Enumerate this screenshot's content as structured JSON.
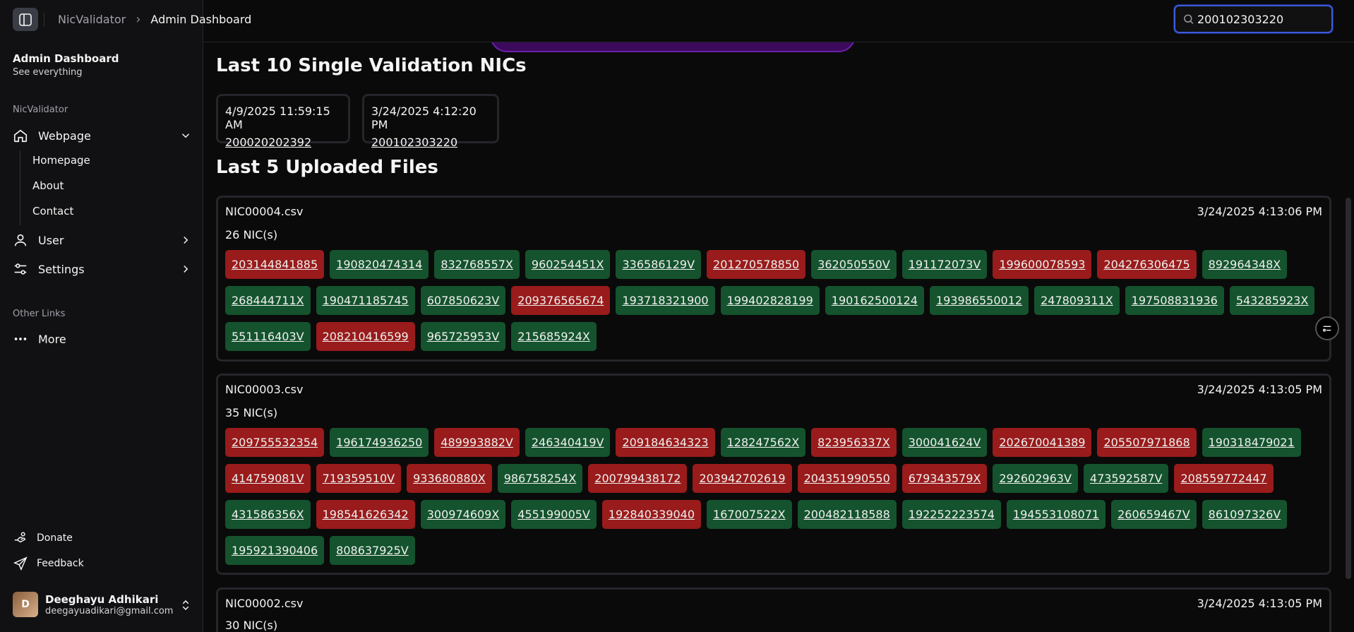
{
  "topbar": {
    "breadcrumb_root": "NicValidator",
    "breadcrumb_current": "Admin Dashboard",
    "search_value": "200102303220"
  },
  "sidebar": {
    "title": "Admin Dashboard",
    "subtitle": "See everything",
    "group_label": "NicValidator",
    "nav": {
      "webpage": "Webpage",
      "homepage": "Homepage",
      "about": "About",
      "contact": "Contact",
      "user": "User",
      "settings": "Settings"
    },
    "other_label": "Other Links",
    "more": "More",
    "donate": "Donate",
    "feedback": "Feedback",
    "user_name": "Deeghayu Adhikari",
    "user_email": "deegayuadikari@gmail.com"
  },
  "main": {
    "recent_heading": "Last 10 Single Validation NICs",
    "recent": [
      {
        "time": "4/9/2025 11:59:15 AM",
        "nic": "200020202392"
      },
      {
        "time": "3/24/2025 4:12:20 PM",
        "nic": "200102303220"
      }
    ],
    "files_heading": "Last 5 Uploaded Files",
    "files": [
      {
        "name": "NIC00004.csv",
        "time": "3/24/2025 4:13:06 PM",
        "count": "26 NIC(s)",
        "nics": [
          {
            "v": "203144841885",
            "ok": false
          },
          {
            "v": "190820474314",
            "ok": true
          },
          {
            "v": "832768557X",
            "ok": true
          },
          {
            "v": "960254451X",
            "ok": true
          },
          {
            "v": "336586129V",
            "ok": true
          },
          {
            "v": "201270578850",
            "ok": false
          },
          {
            "v": "362050550V",
            "ok": true
          },
          {
            "v": "191172073V",
            "ok": true
          },
          {
            "v": "199600078593",
            "ok": false
          },
          {
            "v": "204276306475",
            "ok": false
          },
          {
            "v": "892964348X",
            "ok": true
          },
          {
            "v": "268444711X",
            "ok": true
          },
          {
            "v": "190471185745",
            "ok": true
          },
          {
            "v": "607850623V",
            "ok": true
          },
          {
            "v": "209376565674",
            "ok": false
          },
          {
            "v": "193718321900",
            "ok": true
          },
          {
            "v": "199402828199",
            "ok": true
          },
          {
            "v": "190162500124",
            "ok": true
          },
          {
            "v": "193986550012",
            "ok": true
          },
          {
            "v": "247809311X",
            "ok": true
          },
          {
            "v": "197508831936",
            "ok": true
          },
          {
            "v": "543285923X",
            "ok": true
          },
          {
            "v": "551116403V",
            "ok": true
          },
          {
            "v": "208210416599",
            "ok": false
          },
          {
            "v": "965725953V",
            "ok": true
          },
          {
            "v": "215685924X",
            "ok": true
          }
        ]
      },
      {
        "name": "NIC00003.csv",
        "time": "3/24/2025 4:13:05 PM",
        "count": "35 NIC(s)",
        "nics": [
          {
            "v": "209755532354",
            "ok": false
          },
          {
            "v": "196174936250",
            "ok": true
          },
          {
            "v": "489993882V",
            "ok": false
          },
          {
            "v": "246340419V",
            "ok": true
          },
          {
            "v": "209184634323",
            "ok": false
          },
          {
            "v": "128247562X",
            "ok": true
          },
          {
            "v": "823956337X",
            "ok": false
          },
          {
            "v": "300041624V",
            "ok": true
          },
          {
            "v": "202670041389",
            "ok": false
          },
          {
            "v": "205507971868",
            "ok": false
          },
          {
            "v": "190318479021",
            "ok": true
          },
          {
            "v": "414759081V",
            "ok": false
          },
          {
            "v": "719359510V",
            "ok": false
          },
          {
            "v": "933680880X",
            "ok": false
          },
          {
            "v": "986758254X",
            "ok": true
          },
          {
            "v": "200799438172",
            "ok": false
          },
          {
            "v": "203942702619",
            "ok": false
          },
          {
            "v": "204351990550",
            "ok": false
          },
          {
            "v": "679343579X",
            "ok": false
          },
          {
            "v": "292602963V",
            "ok": true
          },
          {
            "v": "473592587V",
            "ok": true
          },
          {
            "v": "208559772447",
            "ok": false
          },
          {
            "v": "431586356X",
            "ok": true
          },
          {
            "v": "198541626342",
            "ok": false
          },
          {
            "v": "300974609X",
            "ok": true
          },
          {
            "v": "455199005V",
            "ok": true
          },
          {
            "v": "192840339040",
            "ok": false
          },
          {
            "v": "167007522X",
            "ok": true
          },
          {
            "v": "200482118588",
            "ok": true
          },
          {
            "v": "192252223574",
            "ok": true
          },
          {
            "v": "194553108071",
            "ok": true
          },
          {
            "v": "260659467V",
            "ok": true
          },
          {
            "v": "861097326V",
            "ok": true
          },
          {
            "v": "195921390406",
            "ok": true
          },
          {
            "v": "808637925V",
            "ok": true
          }
        ]
      },
      {
        "name": "NIC00002.csv",
        "time": "3/24/2025 4:13:05 PM",
        "count": "30 NIC(s)",
        "nics": []
      }
    ]
  },
  "colors": {
    "valid": "#14532d",
    "invalid": "#991b1b",
    "accent": "#3b5bdb"
  }
}
